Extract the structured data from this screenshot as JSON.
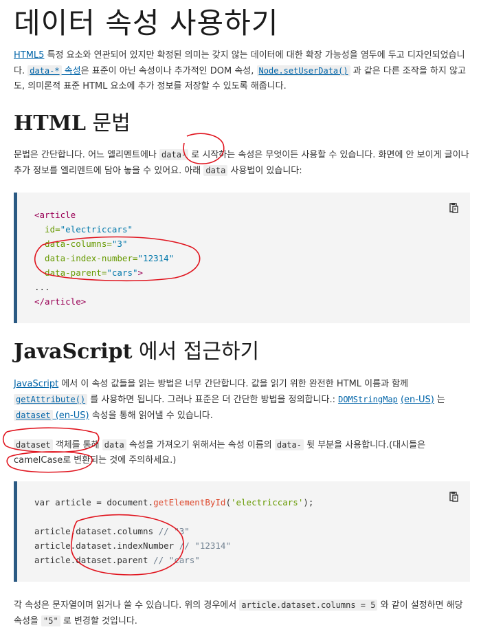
{
  "page": {
    "title": "데이터 속성 사용하기"
  },
  "intro": {
    "link_html5": "HTML5",
    "text_1": " 특정 요소와 연관되어 있지만 확정된 의미는 갖지 않는 데이터에 대한 확장 가능성을 염두에 두고 디자인되었습니다. ",
    "link_data_attr": "data-*",
    "link_data_attr_suffix": " 속성",
    "text_2": "은 표준이 아닌 속성이나 추가적인 DOM 속성, ",
    "code_setuserdata": "Node.setUserData()",
    "text_3": " 과 같은 다른 조작을 하지 않고도, 의미론적 표준 HTML 요소에 추가 정보를 저장할 수 있도록 해줍니다."
  },
  "html_syntax": {
    "heading_en": "HTML",
    "heading_ko": " 문법",
    "text_1": "문법은 간단합니다. 어느 엘리멘트에나 ",
    "code_data": "data-",
    "text_2": " 로 시작하는 속성은 무엇이든 사용할 수 있습니다. 화면에 안 보이게 글이나 추가 정보를 엘리멘트에 담아 놓을 수 있어요. 아래 ",
    "code_data2": "data",
    "text_3": " 사용법이 있습니다:",
    "code_lines": [
      {
        "parts": [
          {
            "t": "<article",
            "c": "tag"
          }
        ]
      },
      {
        "parts": [
          {
            "t": "  id=",
            "c": "attr"
          },
          {
            "t": "\"electriccars\"",
            "c": "val"
          }
        ]
      },
      {
        "parts": [
          {
            "t": "  data-columns=",
            "c": "attr"
          },
          {
            "t": "\"3\"",
            "c": "val"
          }
        ]
      },
      {
        "parts": [
          {
            "t": "  data-index-number=",
            "c": "attr"
          },
          {
            "t": "\"12314\"",
            "c": "val"
          }
        ]
      },
      {
        "parts": [
          {
            "t": "  data-parent=",
            "c": "attr"
          },
          {
            "t": "\"cars\"",
            "c": "val"
          },
          {
            "t": ">",
            "c": "tag"
          }
        ]
      },
      {
        "parts": [
          {
            "t": "...",
            "c": ""
          }
        ]
      },
      {
        "parts": [
          {
            "t": "</article>",
            "c": "tag"
          }
        ]
      }
    ]
  },
  "js_access": {
    "heading_en": "JavaScript",
    "heading_ko": " 에서 접근하기",
    "link_js": "JavaScript",
    "text_1": " 에서 이 속성 값들을 읽는 방법은 너무 간단합니다. 값을 읽기 위한 완전한 HTML 이름과 함께 ",
    "link_getattribute": "getAttribute()",
    "text_2": " 를 사용하면 됩니다. 그러나 표준은 더 간단한 방법을 정의합니다.: ",
    "link_domstringmap": "DOMStringMap",
    "link_enus_1": "(en-US)",
    "text_3": " 는 ",
    "link_dataset": "dataset",
    "link_enus_2": " (en-US)",
    "text_4": " 속성을 통해 읽어낼 수 있습니다.",
    "p2_code_dataset": "dataset",
    "p2_text_1": " 객체를 통해 ",
    "p2_code_data": "data",
    "p2_text_2": " 속성을 가져오기 위해서는 속성 이름의 ",
    "p2_code_data2": "data-",
    "p2_text_3": " 뒷 부분을 사용합니다.(대시들은 camelCase로 변환되는 것에 주의하세요.)",
    "code_lines": [
      {
        "parts": [
          {
            "t": "var article = document.",
            "c": ""
          },
          {
            "t": "getElementById",
            "c": "fn"
          },
          {
            "t": "(",
            "c": ""
          },
          {
            "t": "'electriccars'",
            "c": "str"
          },
          {
            "t": ");",
            "c": ""
          }
        ]
      },
      {
        "parts": [
          {
            "t": "",
            "c": ""
          }
        ]
      },
      {
        "parts": [
          {
            "t": "article.dataset.columns ",
            "c": ""
          },
          {
            "t": "// \"3\"",
            "c": "comment"
          }
        ]
      },
      {
        "parts": [
          {
            "t": "article.dataset.indexNumber ",
            "c": ""
          },
          {
            "t": "// \"12314\"",
            "c": "comment"
          }
        ]
      },
      {
        "parts": [
          {
            "t": "article.dataset.parent ",
            "c": ""
          },
          {
            "t": "// \"cars\"",
            "c": "comment"
          }
        ]
      }
    ],
    "p3_text_1": "각 속성은 문자열이며 읽거나 쓸 수 있습니다. 위의 경우에서 ",
    "p3_code_1": "article.dataset.columns = 5",
    "p3_text_2": " 와 같이 설정하면 해당 속성을 ",
    "p3_code_2": "\"5\"",
    "p3_text_3": " 로 변경할 것입니다."
  },
  "icons": {
    "copy": "clipboard-copy-icon"
  },
  "annotation_color": "#e0141e"
}
